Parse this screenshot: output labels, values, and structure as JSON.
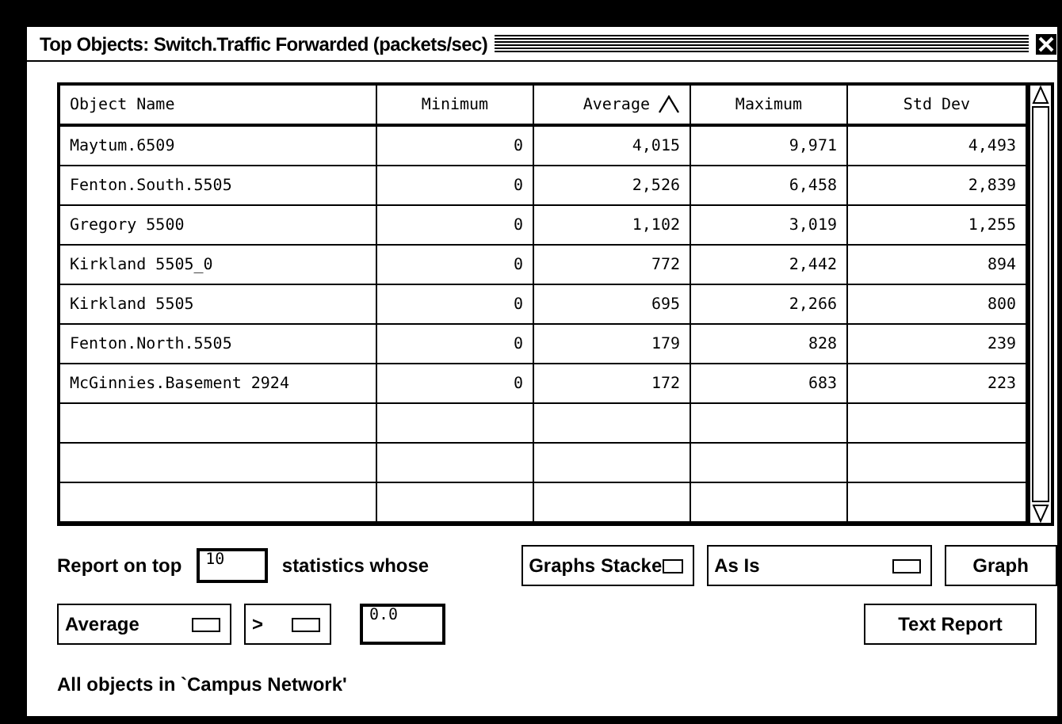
{
  "window": {
    "title": "Top Objects: Switch.Traffic Forwarded (packets/sec)"
  },
  "table": {
    "columns": [
      {
        "label": "Object Name",
        "sorted": false
      },
      {
        "label": "Minimum",
        "sorted": false
      },
      {
        "label": "Average",
        "sorted": true
      },
      {
        "label": "Maximum",
        "sorted": false
      },
      {
        "label": "Std Dev",
        "sorted": false
      }
    ],
    "rows": [
      [
        "Maytum.6509",
        "0",
        "4,015",
        "9,971",
        "4,493"
      ],
      [
        "Fenton.South.5505",
        "0",
        "2,526",
        "6,458",
        "2,839"
      ],
      [
        "Gregory 5500",
        "0",
        "1,102",
        "3,019",
        "1,255"
      ],
      [
        "Kirkland 5505_0",
        "0",
        "772",
        "2,442",
        "894"
      ],
      [
        "Kirkland 5505",
        "0",
        "695",
        "2,266",
        "800"
      ],
      [
        "Fenton.North.5505",
        "0",
        "179",
        "828",
        "239"
      ],
      [
        "McGinnies.Basement 2924",
        "0",
        "172",
        "683",
        "223"
      ]
    ]
  },
  "controls": {
    "report_label": "Report on top",
    "top_count": "10",
    "statistics_label": "statistics whose",
    "graph_style": "Graphs Stacke",
    "order": "As Is",
    "graph_button": "Graph",
    "statistic": "Average",
    "operator": ">",
    "threshold": "0.0",
    "text_report_button": "Text Report"
  },
  "status": "All objects in `Campus Network'"
}
